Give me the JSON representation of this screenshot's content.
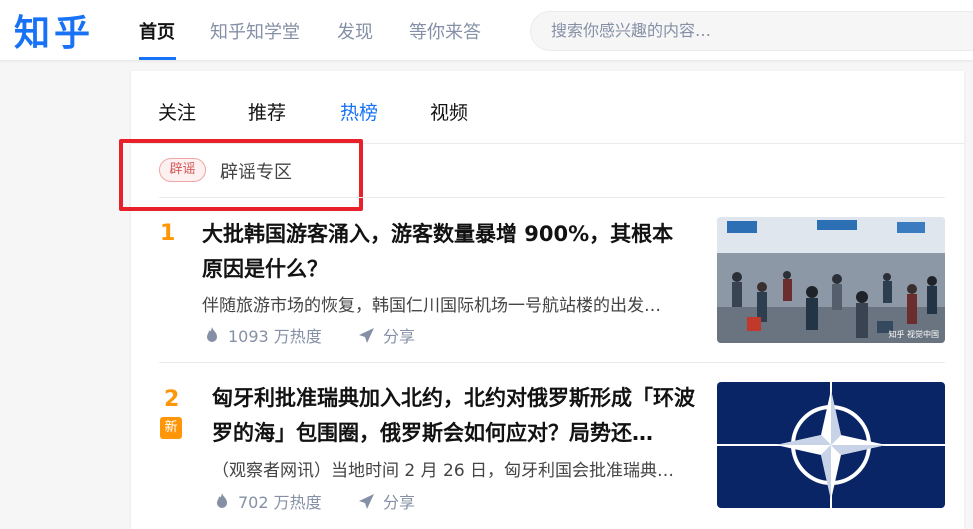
{
  "header": {
    "logo": "知乎",
    "nav": [
      "首页",
      "知乎知学堂",
      "发现",
      "等你来答"
    ],
    "search_placeholder": "搜索你感兴趣的内容…"
  },
  "feed_tabs": [
    "关注",
    "推荐",
    "热榜",
    "视频"
  ],
  "active_tab": "热榜",
  "rumor": {
    "badge": "辟谣",
    "label": "辟谣专区"
  },
  "hot_list": [
    {
      "rank": "1",
      "title": "大批韩国游客涌入，游客数量暴增 900%，其根本原因是什么？",
      "excerpt": "伴随旅游市场的恢复，韩国仁川国际机场一号航站楼的出发…",
      "heat": "1093 万热度",
      "share": "分享",
      "image_caption": "知乎 视觉中国"
    },
    {
      "rank": "2",
      "badge": "新",
      "title": "匈牙利批准瑞典加入北约，北约对俄罗斯形成「环波罗的海」包围圈，俄罗斯会如何应对？局势还…",
      "excerpt": "（观察者网讯）当地时间 2 月 26 日，匈牙利国会批准瑞典…",
      "heat": "702 万热度",
      "share": "分享"
    }
  ],
  "colors": {
    "brand": "#1772f6",
    "rank": "#ff9607",
    "highlight": "#e8202a"
  }
}
